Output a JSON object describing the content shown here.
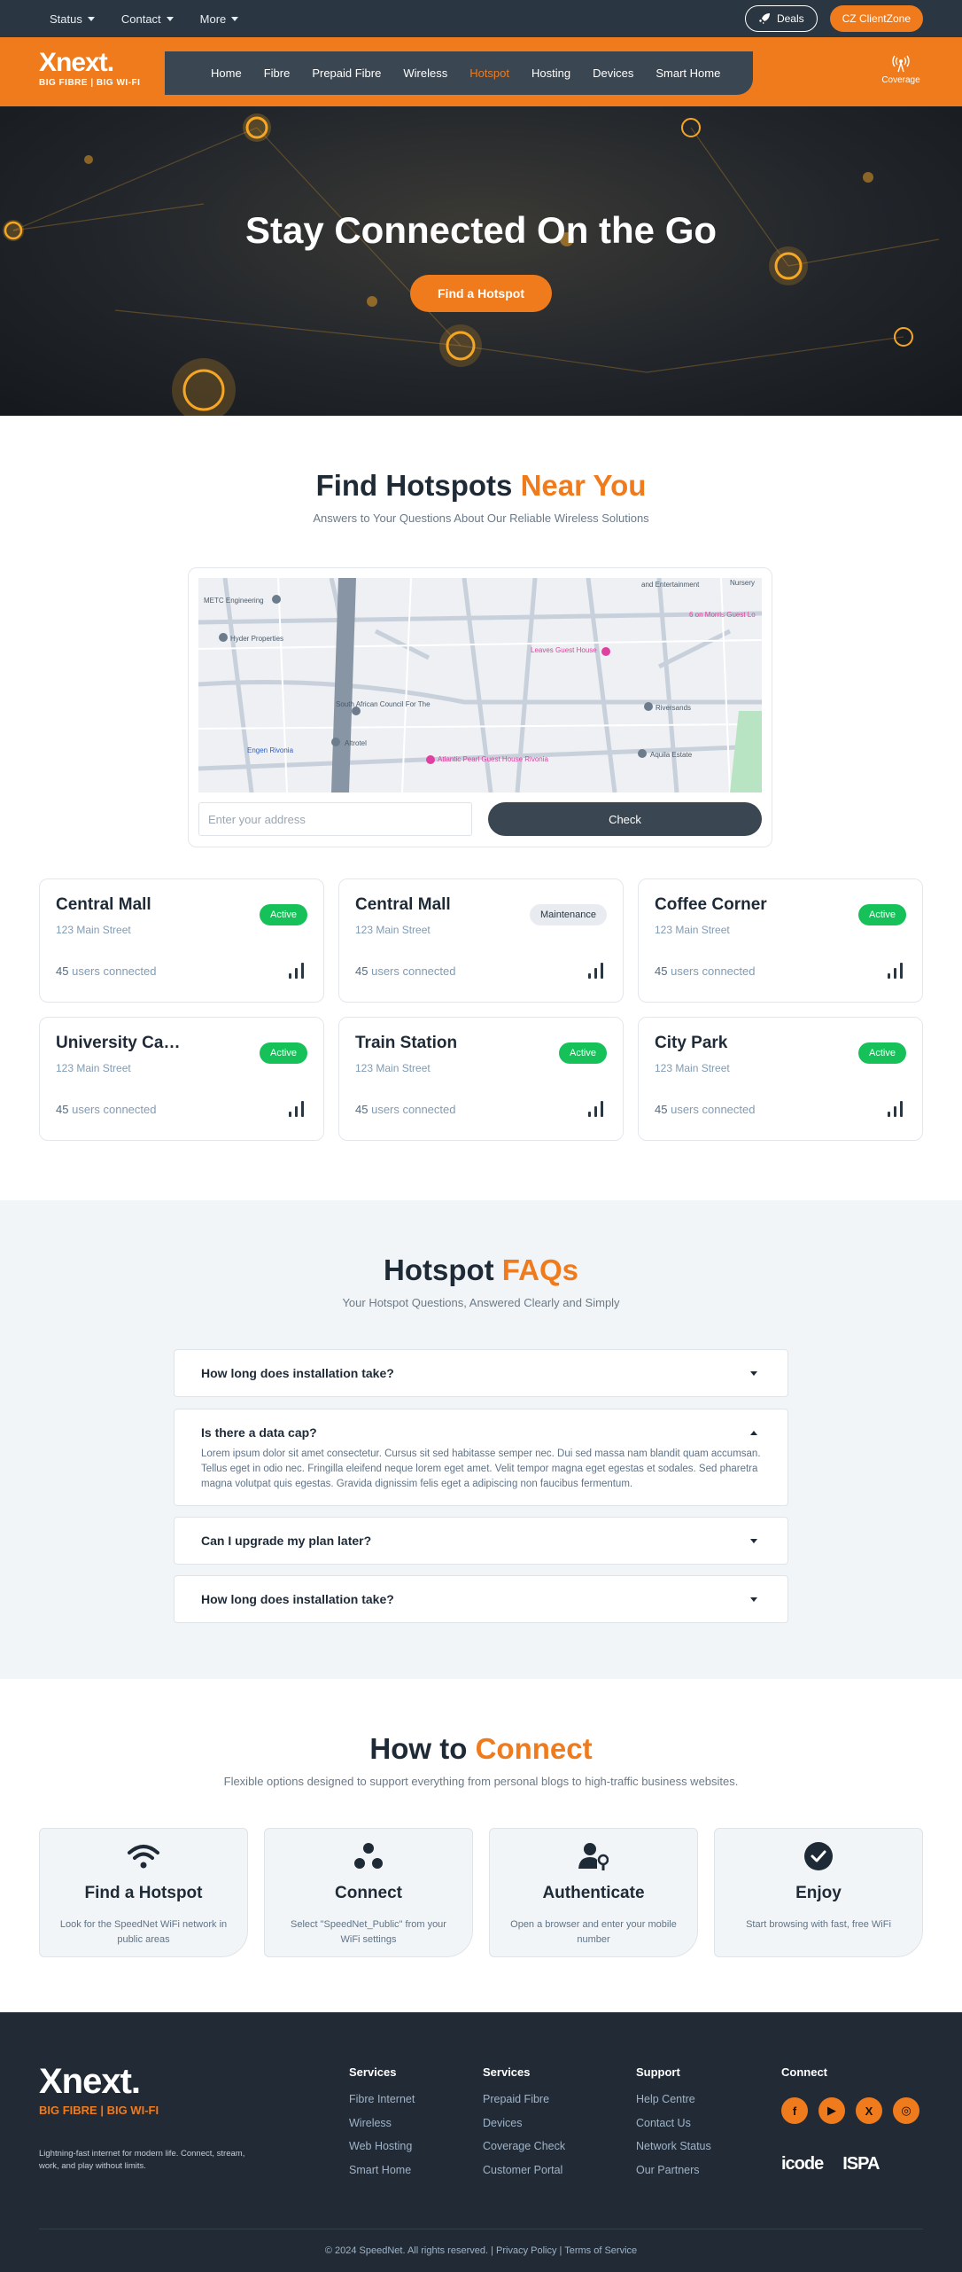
{
  "topbar": {
    "nav": [
      "Status",
      "Contact",
      "More"
    ],
    "deals_label": "Deals",
    "clientzone_label": "CZ ClientZone"
  },
  "header": {
    "logo_word": "Xnext.",
    "logo_tag": "BIG FIBRE | BIG WI-FI",
    "nav": [
      "Home",
      "Fibre",
      "Prepaid Fibre",
      "Wireless",
      "Hotspot",
      "Hosting",
      "Devices",
      "Smart Home"
    ],
    "active_nav": "Hotspot",
    "coverage_label": "Coverage"
  },
  "hero": {
    "title": "Stay Connected On the Go",
    "cta": "Find a Hotspot"
  },
  "find": {
    "title": "Find Hotspots",
    "title_accent": "Near You",
    "subtitle": "Answers to Your Questions About Our Reliable Wireless Solutions",
    "map_labels": [
      "METC Engineering",
      "Hyder Properties",
      "South African Council For The",
      "Altrotel",
      "Engen Rivonia",
      "Leaves Guest House",
      "Atlantic Pearl Guest House Rivonia",
      "Riversands",
      "Aquila Estate",
      "6 on Morris Guest Lo",
      "Nursery",
      "and Entertainment"
    ],
    "address_placeholder": "Enter your address",
    "check_label": "Check"
  },
  "hotspots": [
    {
      "name": "Central Mall",
      "street": "123 Main Street",
      "status": "Active",
      "users": "45",
      "users_label": "users connected"
    },
    {
      "name": "Central Mall",
      "street": "123 Main Street",
      "status": "Maintenance",
      "users": "45",
      "users_label": "users connected"
    },
    {
      "name": "Coffee Corner",
      "street": "123 Main Street",
      "status": "Active",
      "users": "45",
      "users_label": "users connected"
    },
    {
      "name": "University Campus",
      "street": "123 Main Street",
      "status": "Active",
      "users": "45",
      "users_label": "users connected"
    },
    {
      "name": "Train Station",
      "street": "123 Main Street",
      "status": "Active",
      "users": "45",
      "users_label": "users connected"
    },
    {
      "name": "City Park",
      "street": "123 Main Street",
      "status": "Active",
      "users": "45",
      "users_label": "users connected"
    }
  ],
  "faq": {
    "title": "Hotspot",
    "title_accent": "FAQs",
    "subtitle": "Your Hotspot Questions, Answered Clearly and Simply",
    "items": [
      {
        "q": "How long does installation take?",
        "open": false,
        "a": ""
      },
      {
        "q": "Is there a data cap?",
        "open": true,
        "a": "Lorem ipsum dolor sit amet consectetur. Cursus sit sed habitasse semper nec. Dui sed massa nam blandit quam accumsan. Tellus eget in odio nec. Fringilla eleifend neque lorem eget amet. Velit tempor magna eget egestas et sodales. Sed pharetra magna volutpat quis egestas. Gravida dignissim felis eget a adipiscing non faucibus fermentum."
      },
      {
        "q": "Can I upgrade my plan later?",
        "open": false,
        "a": ""
      },
      {
        "q": "How long does installation take?",
        "open": false,
        "a": ""
      }
    ]
  },
  "howto": {
    "title": "How to",
    "title_accent": "Connect",
    "subtitle": "Flexible options designed to support everything from personal blogs to high-traffic business websites.",
    "steps": [
      {
        "icon": "wifi-icon",
        "title": "Find a Hotspot",
        "desc": "Look for the SpeedNet WiFi network in public areas"
      },
      {
        "icon": "connect-icon",
        "title": "Connect",
        "desc": "Select \"SpeedNet_Public\" from your WiFi settings"
      },
      {
        "icon": "user-lock-icon",
        "title": "Authenticate",
        "desc": "Open a browser and enter your mobile number"
      },
      {
        "icon": "check-circle-icon",
        "title": "Enjoy",
        "desc": "Start browsing with fast, free WiFi"
      }
    ]
  },
  "footer": {
    "logo_word": "Xnext.",
    "logo_tag": "BIG FIBRE | BIG WI-FI",
    "description": "Lightning-fast internet for modern life. Connect, stream, work, and play without limits.",
    "columns": [
      {
        "title": "Services",
        "links": [
          "Fibre Internet",
          "Wireless",
          "Web Hosting",
          "Smart Home"
        ]
      },
      {
        "title": "Services",
        "links": [
          "Prepaid Fibre",
          "Devices",
          "Coverage Check",
          "Customer Portal"
        ]
      },
      {
        "title": "Support",
        "links": [
          "Help Centre",
          "Contact Us",
          "Network Status",
          "Our Partners"
        ]
      }
    ],
    "connect_title": "Connect",
    "social": [
      "f",
      "▶",
      "X",
      "◎"
    ],
    "partners": [
      "icode",
      "ISPA"
    ],
    "copyright": "© 2024 SpeedNet. All rights reserved. | Privacy Policy | Terms of Service"
  },
  "colors": {
    "accent": "#f07b1d",
    "dark": "#2a3642",
    "active": "#16c15a"
  }
}
